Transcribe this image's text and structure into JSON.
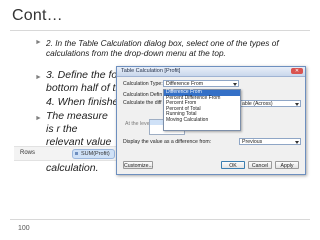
{
  "slide": {
    "title": "Cont…",
    "bullets": [
      "2. In the Table Calculation dialog box, select one of the types of calculations from the drop-down menu at the top.",
      "3. Define the form bottom half of the",
      "4. When finished",
      "The measure is r the relevant value table calculation."
    ],
    "page_number": "100"
  },
  "rows_shelf": {
    "label": "Rows",
    "pill": "SUM(Profit)"
  },
  "dialog": {
    "title": "Table Calculation [Profit]",
    "close_glyph": "✕",
    "calc_type_label": "Calculation Type:",
    "calc_type_value": "Difference From",
    "calc_defn_label": "Calculation Defin",
    "calc_diff_label": "Calculate the diff",
    "at_level_label": "At the level:",
    "table_across_value": "able (Across)",
    "display_label": "Display the value as a difference from:",
    "display_value": "Previous",
    "dropdown_options": [
      "Difference From",
      "Percent Difference From",
      "Percent From",
      "Percent of Total",
      "Running Total",
      "Moving Calculation"
    ],
    "customize_button": "Customize...",
    "ok_button": "OK",
    "cancel_button": "Cancel",
    "apply_button": "Apply"
  }
}
